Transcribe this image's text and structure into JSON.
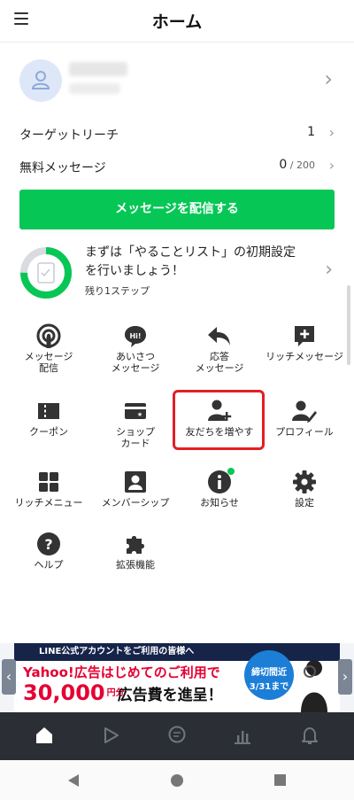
{
  "header": {
    "title": "ホーム",
    "menu_icon": "hamburger-icon"
  },
  "account": {
    "avatar_icon": "user-icon"
  },
  "stats": [
    {
      "label": "ターゲットリーチ",
      "value": "1"
    },
    {
      "label": "無料メッセージ",
      "value": "0",
      "limit": " / 200"
    }
  ],
  "primary_button": {
    "label": "メッセージを配信する"
  },
  "todo": {
    "text": "まずは「やることリスト」の初期設定を行いましょう！",
    "sub": "残り1ステップ",
    "progress": 0.75
  },
  "menu": [
    {
      "label": "メッセージ\n配信",
      "icon": "broadcast-icon"
    },
    {
      "label": "あいさつ\nメッセージ",
      "icon": "greeting-icon"
    },
    {
      "label": "応答\nメッセージ",
      "icon": "reply-icon"
    },
    {
      "label": "リッチメッセージ",
      "icon": "rich-message-icon"
    },
    {
      "label": "クーポン",
      "icon": "coupon-icon"
    },
    {
      "label": "ショップ\nカード",
      "icon": "shop-card-icon"
    },
    {
      "label": "友だちを増やす",
      "icon": "add-friend-icon",
      "highlighted": true
    },
    {
      "label": "プロフィール",
      "icon": "profile-icon"
    },
    {
      "label": "リッチメニュー",
      "icon": "rich-menu-icon"
    },
    {
      "label": "メンバーシップ",
      "icon": "membership-icon"
    },
    {
      "label": "お知らせ",
      "icon": "info-icon",
      "badge": true
    },
    {
      "label": "設定",
      "icon": "gear-icon"
    },
    {
      "label": "ヘルプ",
      "icon": "help-icon"
    },
    {
      "label": "拡張機能",
      "icon": "puzzle-icon"
    }
  ],
  "banner": {
    "top_text": "LINE公式アカウントをご利用の皆様へ",
    "line1": "Yahoo!広告はじめてのご利用で",
    "amount": "30,000",
    "amount_unit": "円分",
    "line2_tail": "広告費を進呈！",
    "deadline_label": "締切間近",
    "deadline_date": "3/31まで"
  },
  "tabbar": [
    {
      "name": "home",
      "icon": "home-icon",
      "active": true
    },
    {
      "name": "chat-start",
      "icon": "play-icon"
    },
    {
      "name": "chat",
      "icon": "chat-icon"
    },
    {
      "name": "analytics",
      "icon": "chart-icon"
    },
    {
      "name": "notifications",
      "icon": "bell-icon"
    }
  ],
  "colors": {
    "accent": "#06c755",
    "highlight": "#e21f26",
    "tabbar": "#2b2f35"
  }
}
